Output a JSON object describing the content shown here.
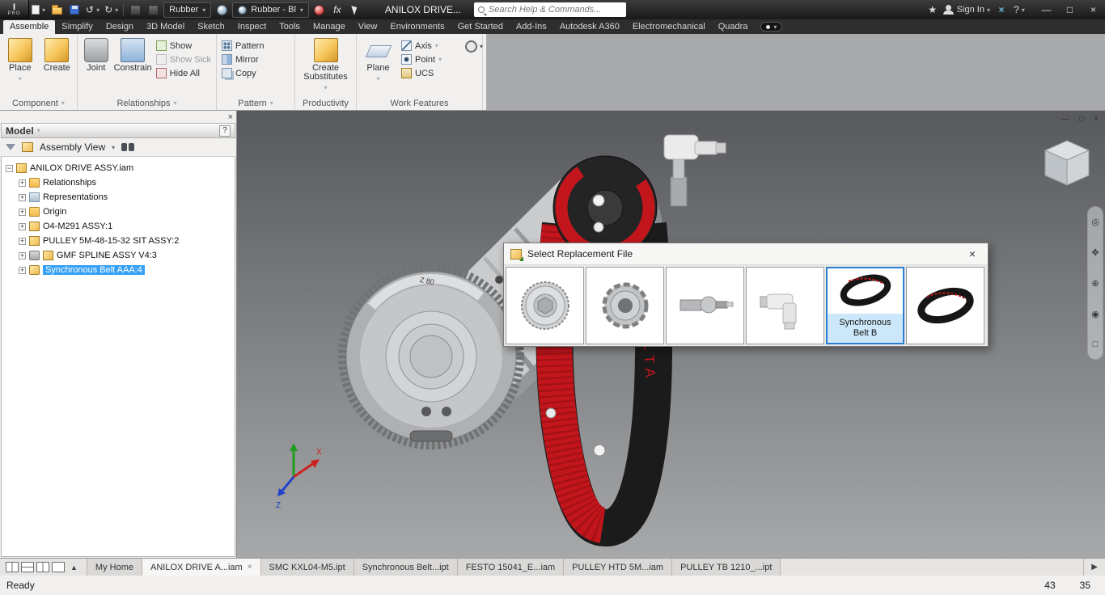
{
  "ui": {
    "logo_i": "I",
    "caret": "▾",
    "caret_up": "▲",
    "plus": "+",
    "minus": "−",
    "close": "×",
    "min": "—",
    "max": "□",
    "help": "?",
    "undo": "↺",
    "redo": "↻",
    "star": "★",
    "arrow_right": "▶",
    "nav_wheel": "◎",
    "nav_pan": "✥",
    "nav_zoom": "⊕",
    "nav_orbit": "◉",
    "nav_look": "□"
  },
  "titlebar": {
    "logo_text": "PRO",
    "appearance_value": "Rubber",
    "material_value": "Rubber - Bl",
    "fx_label": "fx",
    "doc_title": "ANILOX DRIVE...",
    "search_placeholder": "Search Help & Commands...",
    "sign_in": "Sign In"
  },
  "ribbon_tabs": [
    {
      "label": "Assemble"
    },
    {
      "label": "Simplify"
    },
    {
      "label": "Design"
    },
    {
      "label": "3D Model"
    },
    {
      "label": "Sketch"
    },
    {
      "label": "Inspect"
    },
    {
      "label": "Tools"
    },
    {
      "label": "Manage"
    },
    {
      "label": "View"
    },
    {
      "label": "Environments"
    },
    {
      "label": "Get Started"
    },
    {
      "label": "Add-Ins"
    },
    {
      "label": "Autodesk A360"
    },
    {
      "label": "Electromechanical"
    },
    {
      "label": "Quadra"
    }
  ],
  "ribbon": {
    "place": "Place",
    "create": "Create",
    "joint": "Joint",
    "constrain": "Constrain",
    "show": "Show",
    "show_sick": "Show Sick",
    "hide_all": "Hide All",
    "pattern": "Pattern",
    "mirror": "Mirror",
    "copy": "Copy",
    "create_substitutes": "Create Substitutes",
    "plane": "Plane",
    "axis": "Axis",
    "point": "Point",
    "ucs": "UCS",
    "panel_component": "Component",
    "panel_relationships": "Relationships",
    "panel_pattern": "Pattern",
    "panel_productivity": "Productivity",
    "panel_work_features": "Work Features"
  },
  "browser": {
    "title": "Model",
    "view_mode": "Assembly View",
    "tree": [
      {
        "label": "ANILOX DRIVE ASSY.iam"
      },
      {
        "label": "Relationships"
      },
      {
        "label": "Representations"
      },
      {
        "label": "Origin"
      },
      {
        "label": "O4-M291 ASSY:1"
      },
      {
        "label": "PULLEY 5M-48-15-32 SIT ASSY:2"
      },
      {
        "label": "GMF SPLINE ASSY V4:3"
      },
      {
        "label": "Synchronous Belt AAA:4"
      }
    ]
  },
  "viewport": {
    "gear_label": "Z 80",
    "belt_text": "DELTA",
    "triad_x": "X",
    "triad_z": "Z"
  },
  "dialog": {
    "title": "Select Replacement File",
    "selected_label_line1": "Synchronous",
    "selected_label_line2": "Belt B"
  },
  "doc_tabs": [
    {
      "label": "My Home"
    },
    {
      "label": "ANILOX DRIVE A...iam"
    },
    {
      "label": "SMC KXL04-M5.ipt"
    },
    {
      "label": "Synchronous Belt...ipt"
    },
    {
      "label": "FESTO 15041_E...iam"
    },
    {
      "label": "PULLEY HTD 5M...iam"
    },
    {
      "label": "PULLEY TB 1210_...ipt"
    }
  ],
  "statusbar": {
    "message": "Ready",
    "value1": "43",
    "value2": "35"
  },
  "colors": {
    "selection_blue": "#35a0f5",
    "dialog_selection": "#2a7fd4",
    "belt_red": "#c3161c",
    "viewport_top": "#57595c",
    "viewport_bottom": "#a6a8aa"
  }
}
